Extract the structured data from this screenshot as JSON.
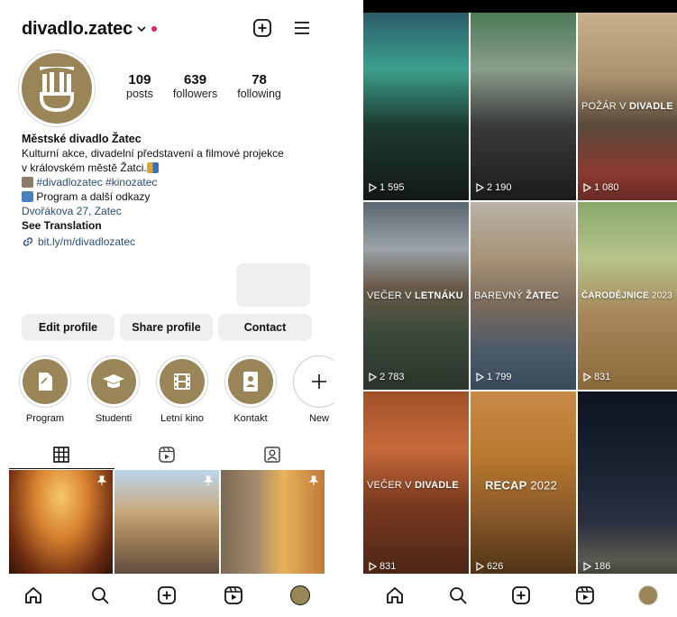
{
  "profile": {
    "username": "divadlo.zatec",
    "stats": [
      {
        "num": "109",
        "label": "posts"
      },
      {
        "num": "639",
        "label": "followers"
      },
      {
        "num": "78",
        "label": "following"
      }
    ],
    "name": "Městské divadlo Žatec",
    "bio_line1": "Kulturní akce, divadelní představení a filmové projekce",
    "bio_line2": "v královském městě Žatci.",
    "hashtags": "#divadlozatec #kinozatec",
    "program_line": "Program a další odkazy",
    "address": "Dvořákova 27, Zatec",
    "see_translation": "See Translation",
    "url": "bit.ly/m/divadlozatec"
  },
  "buttons": {
    "edit": "Edit profile",
    "share": "Share profile",
    "contact": "Contact"
  },
  "highlights": [
    {
      "label": "Program",
      "icon": "document-icon"
    },
    {
      "label": "Studenti",
      "icon": "graduation-cap-icon"
    },
    {
      "label": "Letní kino",
      "icon": "film-icon"
    },
    {
      "label": "Kontakt",
      "icon": "contact-card-icon"
    },
    {
      "label": "New",
      "icon": "plus-icon"
    }
  ],
  "reels": [
    {
      "caption_pre": "",
      "caption_bold": "",
      "views": "1 595"
    },
    {
      "caption_pre": "",
      "caption_bold": "",
      "views": "2 190"
    },
    {
      "caption_pre": "POŽÁR V ",
      "caption_bold": "DIVADLE",
      "views": "1 080"
    },
    {
      "caption_pre": "VEČER V ",
      "caption_bold": "LETNÁKU",
      "views": "2 783"
    },
    {
      "caption_pre": "BAREVNÝ ",
      "caption_bold": "ŽATEC",
      "views": "1 799"
    },
    {
      "caption_pre": "",
      "caption_bold": "ČARODĚJNICE",
      "caption_post": " 2023",
      "views": "831"
    },
    {
      "caption_pre": "VEČER V ",
      "caption_bold": "DIVADLE",
      "views": "831"
    },
    {
      "caption_pre": "",
      "caption_bold": "RECAP",
      "caption_post": " 2022",
      "views": "626"
    },
    {
      "caption_pre": "",
      "caption_bold": "",
      "views": "186"
    }
  ],
  "colors": {
    "brand": "#9a8559",
    "link": "#2b4d7a",
    "notification": "#e0245e"
  }
}
